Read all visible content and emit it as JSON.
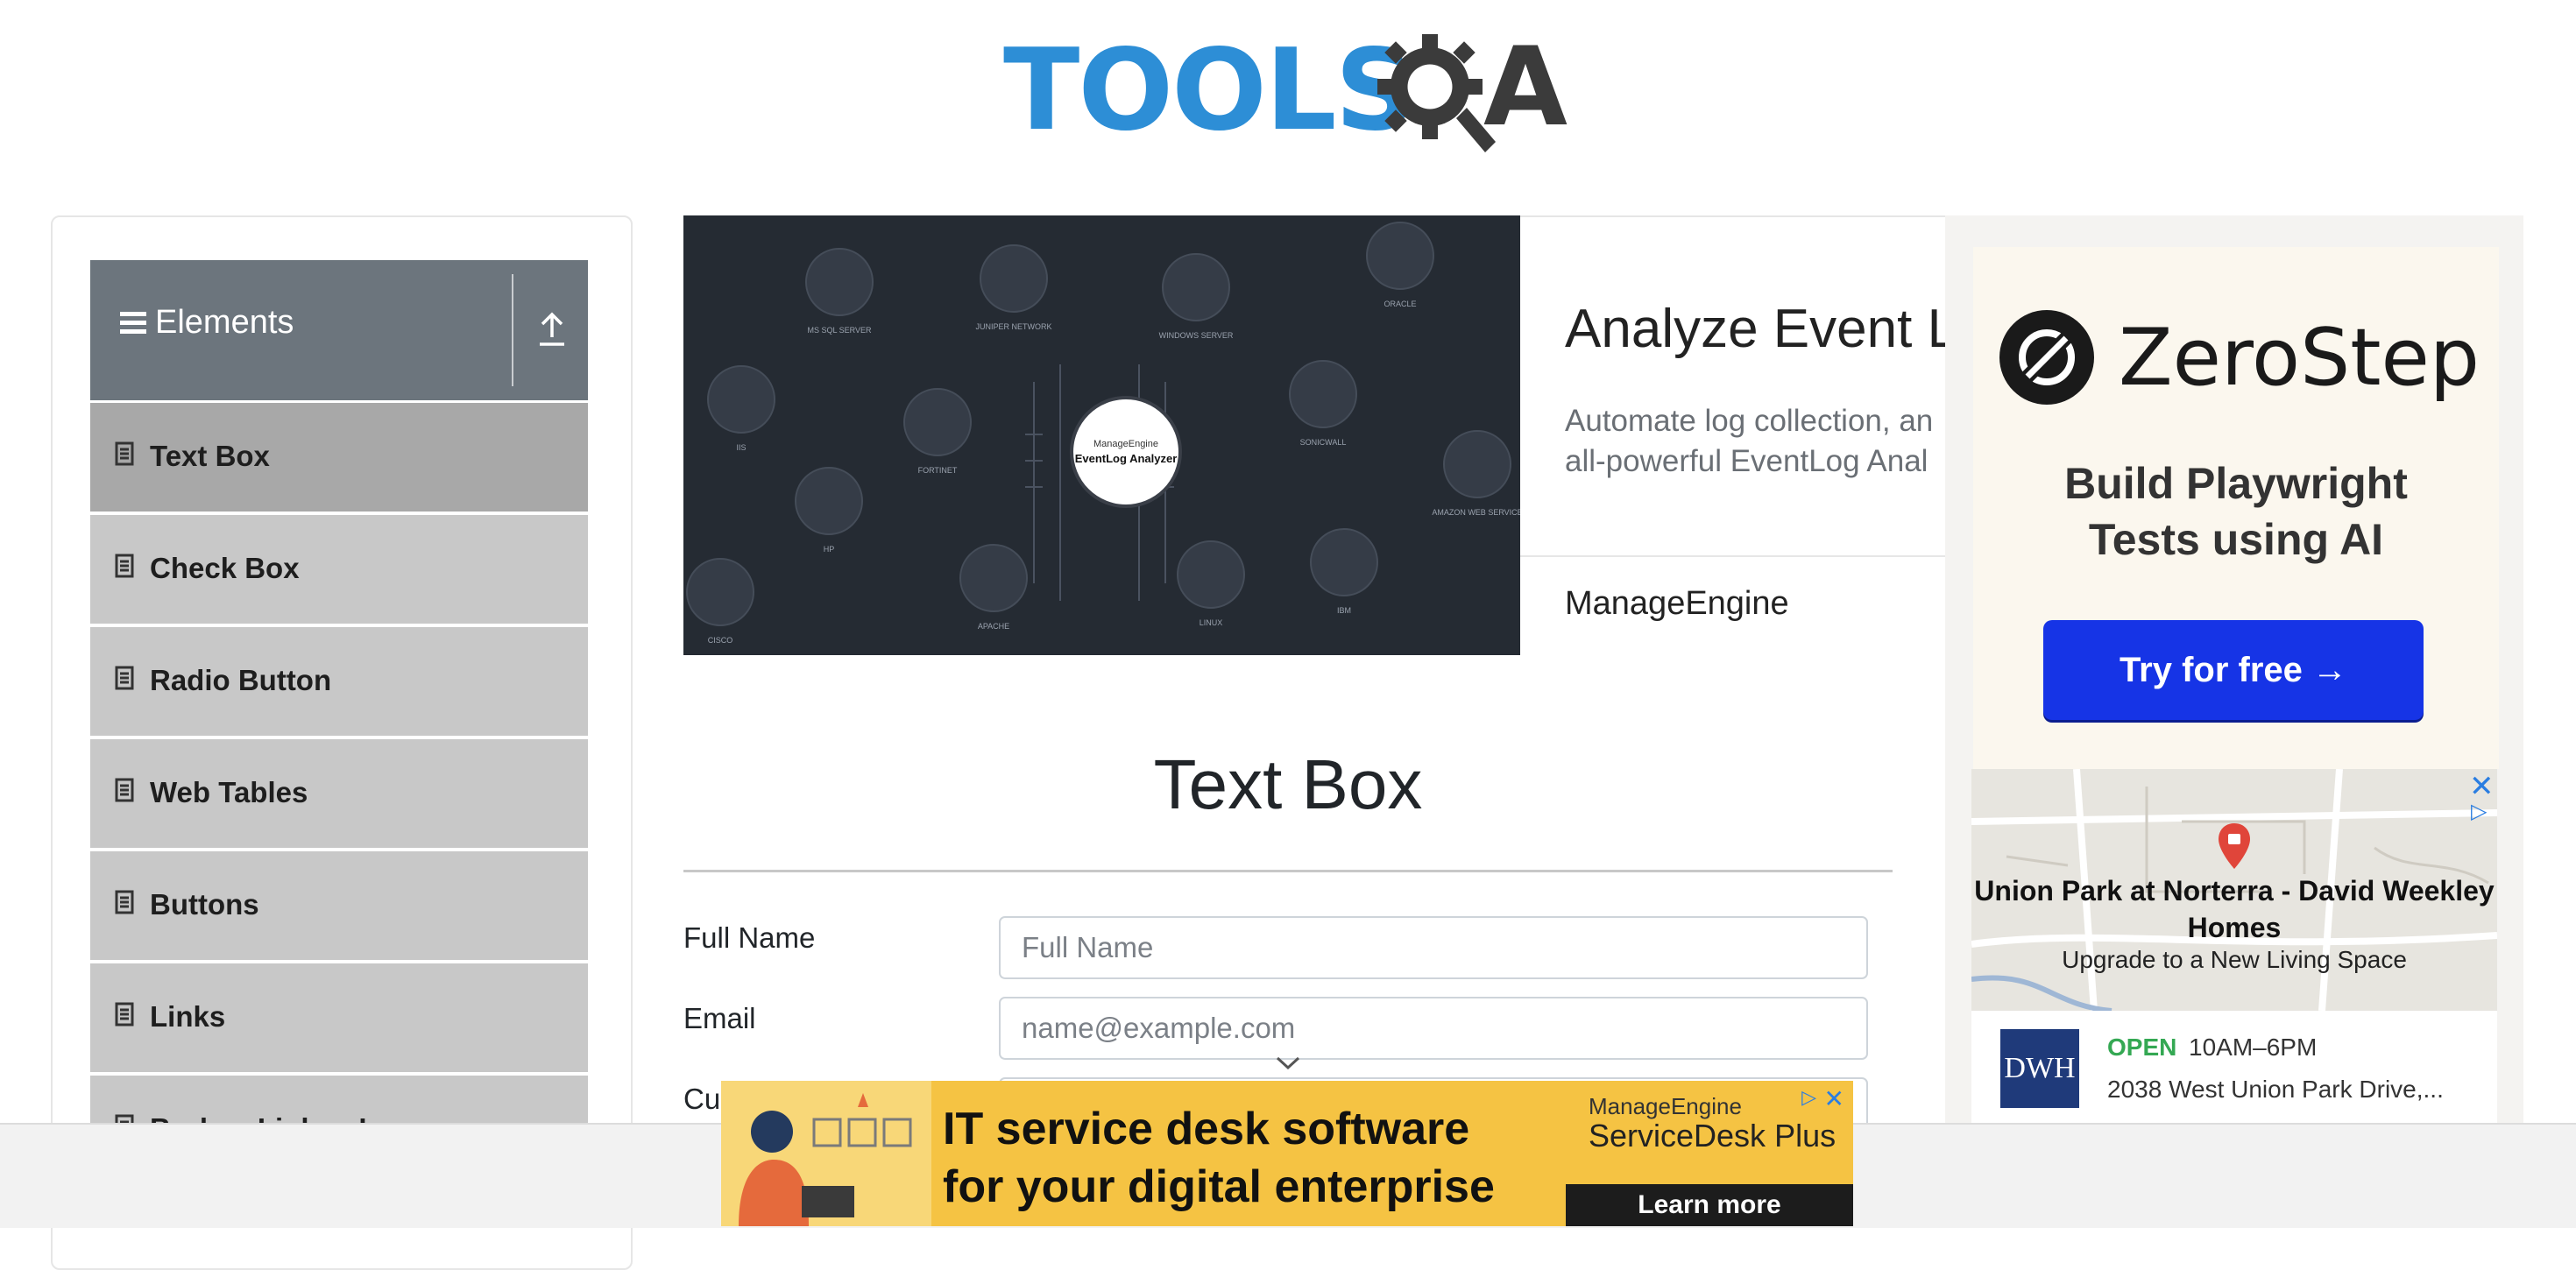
{
  "header": {
    "logo_text": "TOOLS",
    "logo_suffix": "A"
  },
  "sidebar": {
    "group_title": "Elements",
    "items": [
      {
        "label": "Text Box",
        "active": true
      },
      {
        "label": "Check Box"
      },
      {
        "label": "Radio Button"
      },
      {
        "label": "Web Tables"
      },
      {
        "label": "Buttons"
      },
      {
        "label": "Links"
      },
      {
        "label": "Broken Links - Images"
      }
    ]
  },
  "banner_ad": {
    "title": "Analyze Event Lo",
    "desc_line1": "Automate log collection, an",
    "desc_line2": "all-powerful EventLog Anal",
    "brand": "ManageEngine",
    "center_brand": "ManageEngine",
    "center_product": "EventLog Analyzer",
    "nodes": [
      "MS SQL SERVER",
      "JUNIPER NETWORK",
      "WINDOWS SERVER",
      "ORACLE",
      "IIS",
      "FORTINET",
      "SONICWALL",
      "AMAZON WEB SERVICE",
      "HP",
      "APACHE",
      "LINUX",
      "IBM",
      "CISCO"
    ]
  },
  "main": {
    "page_title": "Text Box",
    "fields": [
      {
        "label": "Full Name",
        "placeholder": "Full Name"
      },
      {
        "label": "Email",
        "placeholder": "name@example.com"
      },
      {
        "label": "Current Address",
        "placeholder": ""
      }
    ]
  },
  "right_ad": {
    "brand": "ZeroStep",
    "headline_line1": "Build Playwright",
    "headline_line2": "Tests using AI",
    "cta": "Try for free →",
    "map_title": "Union Park at Norterra - David Weekley Homes",
    "map_sub": "Upgrade to a New Living Space",
    "biz_logo": "DWH",
    "status": "OPEN",
    "hours": "10AM–6PM",
    "address": "2038 West Union Park Drive,..."
  },
  "bottom_ad": {
    "headline_line1": "IT service desk software",
    "headline_line2": "for your digital enterprise",
    "brand_small": "ManageEngine",
    "product": "ServiceDesk Plus",
    "cta": "Learn more"
  },
  "colors": {
    "accent_blue": "#2d8ed6",
    "sidebar_header": "#6c757d",
    "menu_bg": "#c8c8c8",
    "cta_blue": "#1634e6",
    "ad_yellow": "#f5c343"
  }
}
